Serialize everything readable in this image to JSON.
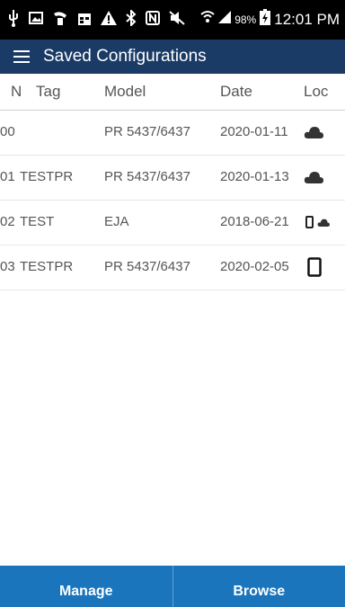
{
  "status_bar": {
    "battery": "98%",
    "time": "12:01 PM",
    "icons": [
      "usb-icon",
      "image-icon",
      "phone-sync-icon",
      "calendar-icon",
      "warning-icon",
      "bluetooth-icon",
      "nfc-icon",
      "mute-icon",
      "wifi-icon",
      "signal-icon",
      "battery-charging-icon"
    ]
  },
  "app_bar": {
    "title": "Saved Configurations",
    "menu_icon": "hamburger-menu-icon",
    "color": "#1a3b66"
  },
  "table": {
    "columns": [
      "N",
      "Tag",
      "Model",
      "Date",
      "Loc"
    ],
    "rows": [
      {
        "n": "00",
        "tag": "",
        "model": "PR 5437/6437",
        "date": "2020-01-11",
        "loc": "cloud"
      },
      {
        "n": "01",
        "tag": "TESTPR",
        "model": "PR 5437/6437",
        "date": "2020-01-13",
        "loc": "cloud"
      },
      {
        "n": "02",
        "tag": "TEST",
        "model": "EJA",
        "date": "2018-06-21",
        "loc": "phone+cloud"
      },
      {
        "n": "03",
        "tag": "TESTPR",
        "model": "PR 5437/6437",
        "date": "2020-02-05",
        "loc": "phone"
      }
    ]
  },
  "bottom_bar": {
    "manage_label": "Manage",
    "browse_label": "Browse",
    "color": "#1b75bc"
  }
}
